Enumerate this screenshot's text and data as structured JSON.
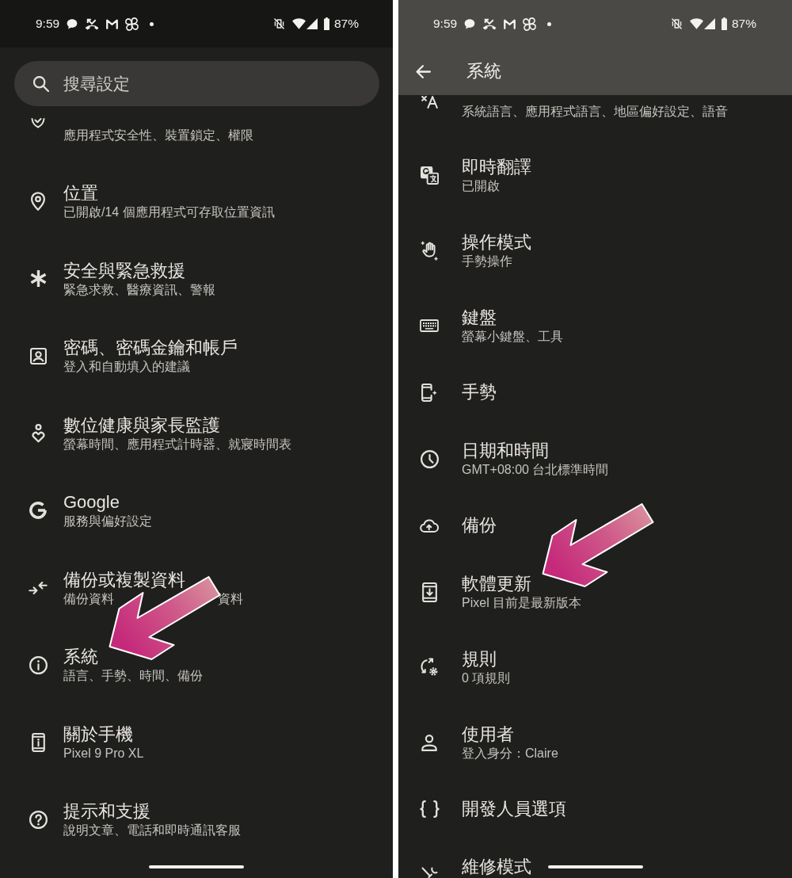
{
  "screens": [
    {
      "kind": "home",
      "status_bar": {
        "time": "9:59",
        "battery": "87%"
      },
      "search": {
        "placeholder": "搜尋設定"
      },
      "items": [
        {
          "kind": "clipped_top",
          "subtitle": "應用程式安全性、裝置鎖定、權限",
          "arrow": false
        },
        {
          "kind": "setting",
          "title": "位置",
          "subtitle": "已開啟/14 個應用程式可存取位置資訊",
          "arrow": false
        },
        {
          "kind": "setting",
          "title": "安全與緊急救援",
          "subtitle": "緊急求救、醫療資訊、警報",
          "arrow": false
        },
        {
          "kind": "setting",
          "title": "密碼、密碼金鑰和帳戶",
          "subtitle": "登入和自動填入的建議",
          "arrow": false
        },
        {
          "kind": "setting",
          "title": "數位健康與家長監護",
          "subtitle": "螢幕時間、應用程式計時器、就寢時間表",
          "arrow": false
        },
        {
          "kind": "setting",
          "title": "Google",
          "subtitle": "服務與偏好設定",
          "arrow": false
        },
        {
          "kind": "setting",
          "title": "備份或複製資料",
          "subtitle_fragments": [
            "備份資料",
            "資料"
          ],
          "arrow": false
        },
        {
          "kind": "setting",
          "title": "系統",
          "subtitle": "語言、手勢、時間、備份",
          "arrow": true
        },
        {
          "kind": "setting",
          "title": "關於手機",
          "subtitle": "Pixel 9 Pro XL",
          "arrow": false
        },
        {
          "kind": "setting",
          "title": "提示和支援",
          "subtitle": "說明文章、電話和即時通訊客服",
          "arrow": false
        }
      ]
    },
    {
      "kind": "subpage",
      "status_bar": {
        "time": "9:59",
        "battery": "87%"
      },
      "app_bar": {
        "title": "系統"
      },
      "items": [
        {
          "kind": "clipped_top",
          "subtitle": "系統語言、應用程式語言、地區偏好設定、語音",
          "arrow": false
        },
        {
          "kind": "setting",
          "title": "即時翻譯",
          "subtitle": "已開啟",
          "arrow": false
        },
        {
          "kind": "setting",
          "title": "操作模式",
          "subtitle": "手勢操作",
          "arrow": false
        },
        {
          "kind": "setting",
          "title": "鍵盤",
          "subtitle": "螢幕小鍵盤、工具",
          "arrow": false
        },
        {
          "kind": "setting",
          "title": "手勢",
          "arrow": false
        },
        {
          "kind": "setting",
          "title": "日期和時間",
          "subtitle": "GMT+08:00 台北標準時間",
          "arrow": false
        },
        {
          "kind": "setting",
          "title": "備份",
          "arrow": false
        },
        {
          "kind": "setting",
          "title": "軟體更新",
          "subtitle": "Pixel 目前是最新版本",
          "arrow": true
        },
        {
          "kind": "setting",
          "title": "規則",
          "subtitle": "0 項規則",
          "arrow": false
        },
        {
          "kind": "setting",
          "title": "使用者",
          "subtitle": "登入身分：Claire",
          "arrow": false
        },
        {
          "kind": "setting",
          "title": "開發人員選項",
          "arrow": false
        },
        {
          "kind": "clipped_bottom",
          "title": "維修模式",
          "arrow": false
        }
      ]
    }
  ]
}
